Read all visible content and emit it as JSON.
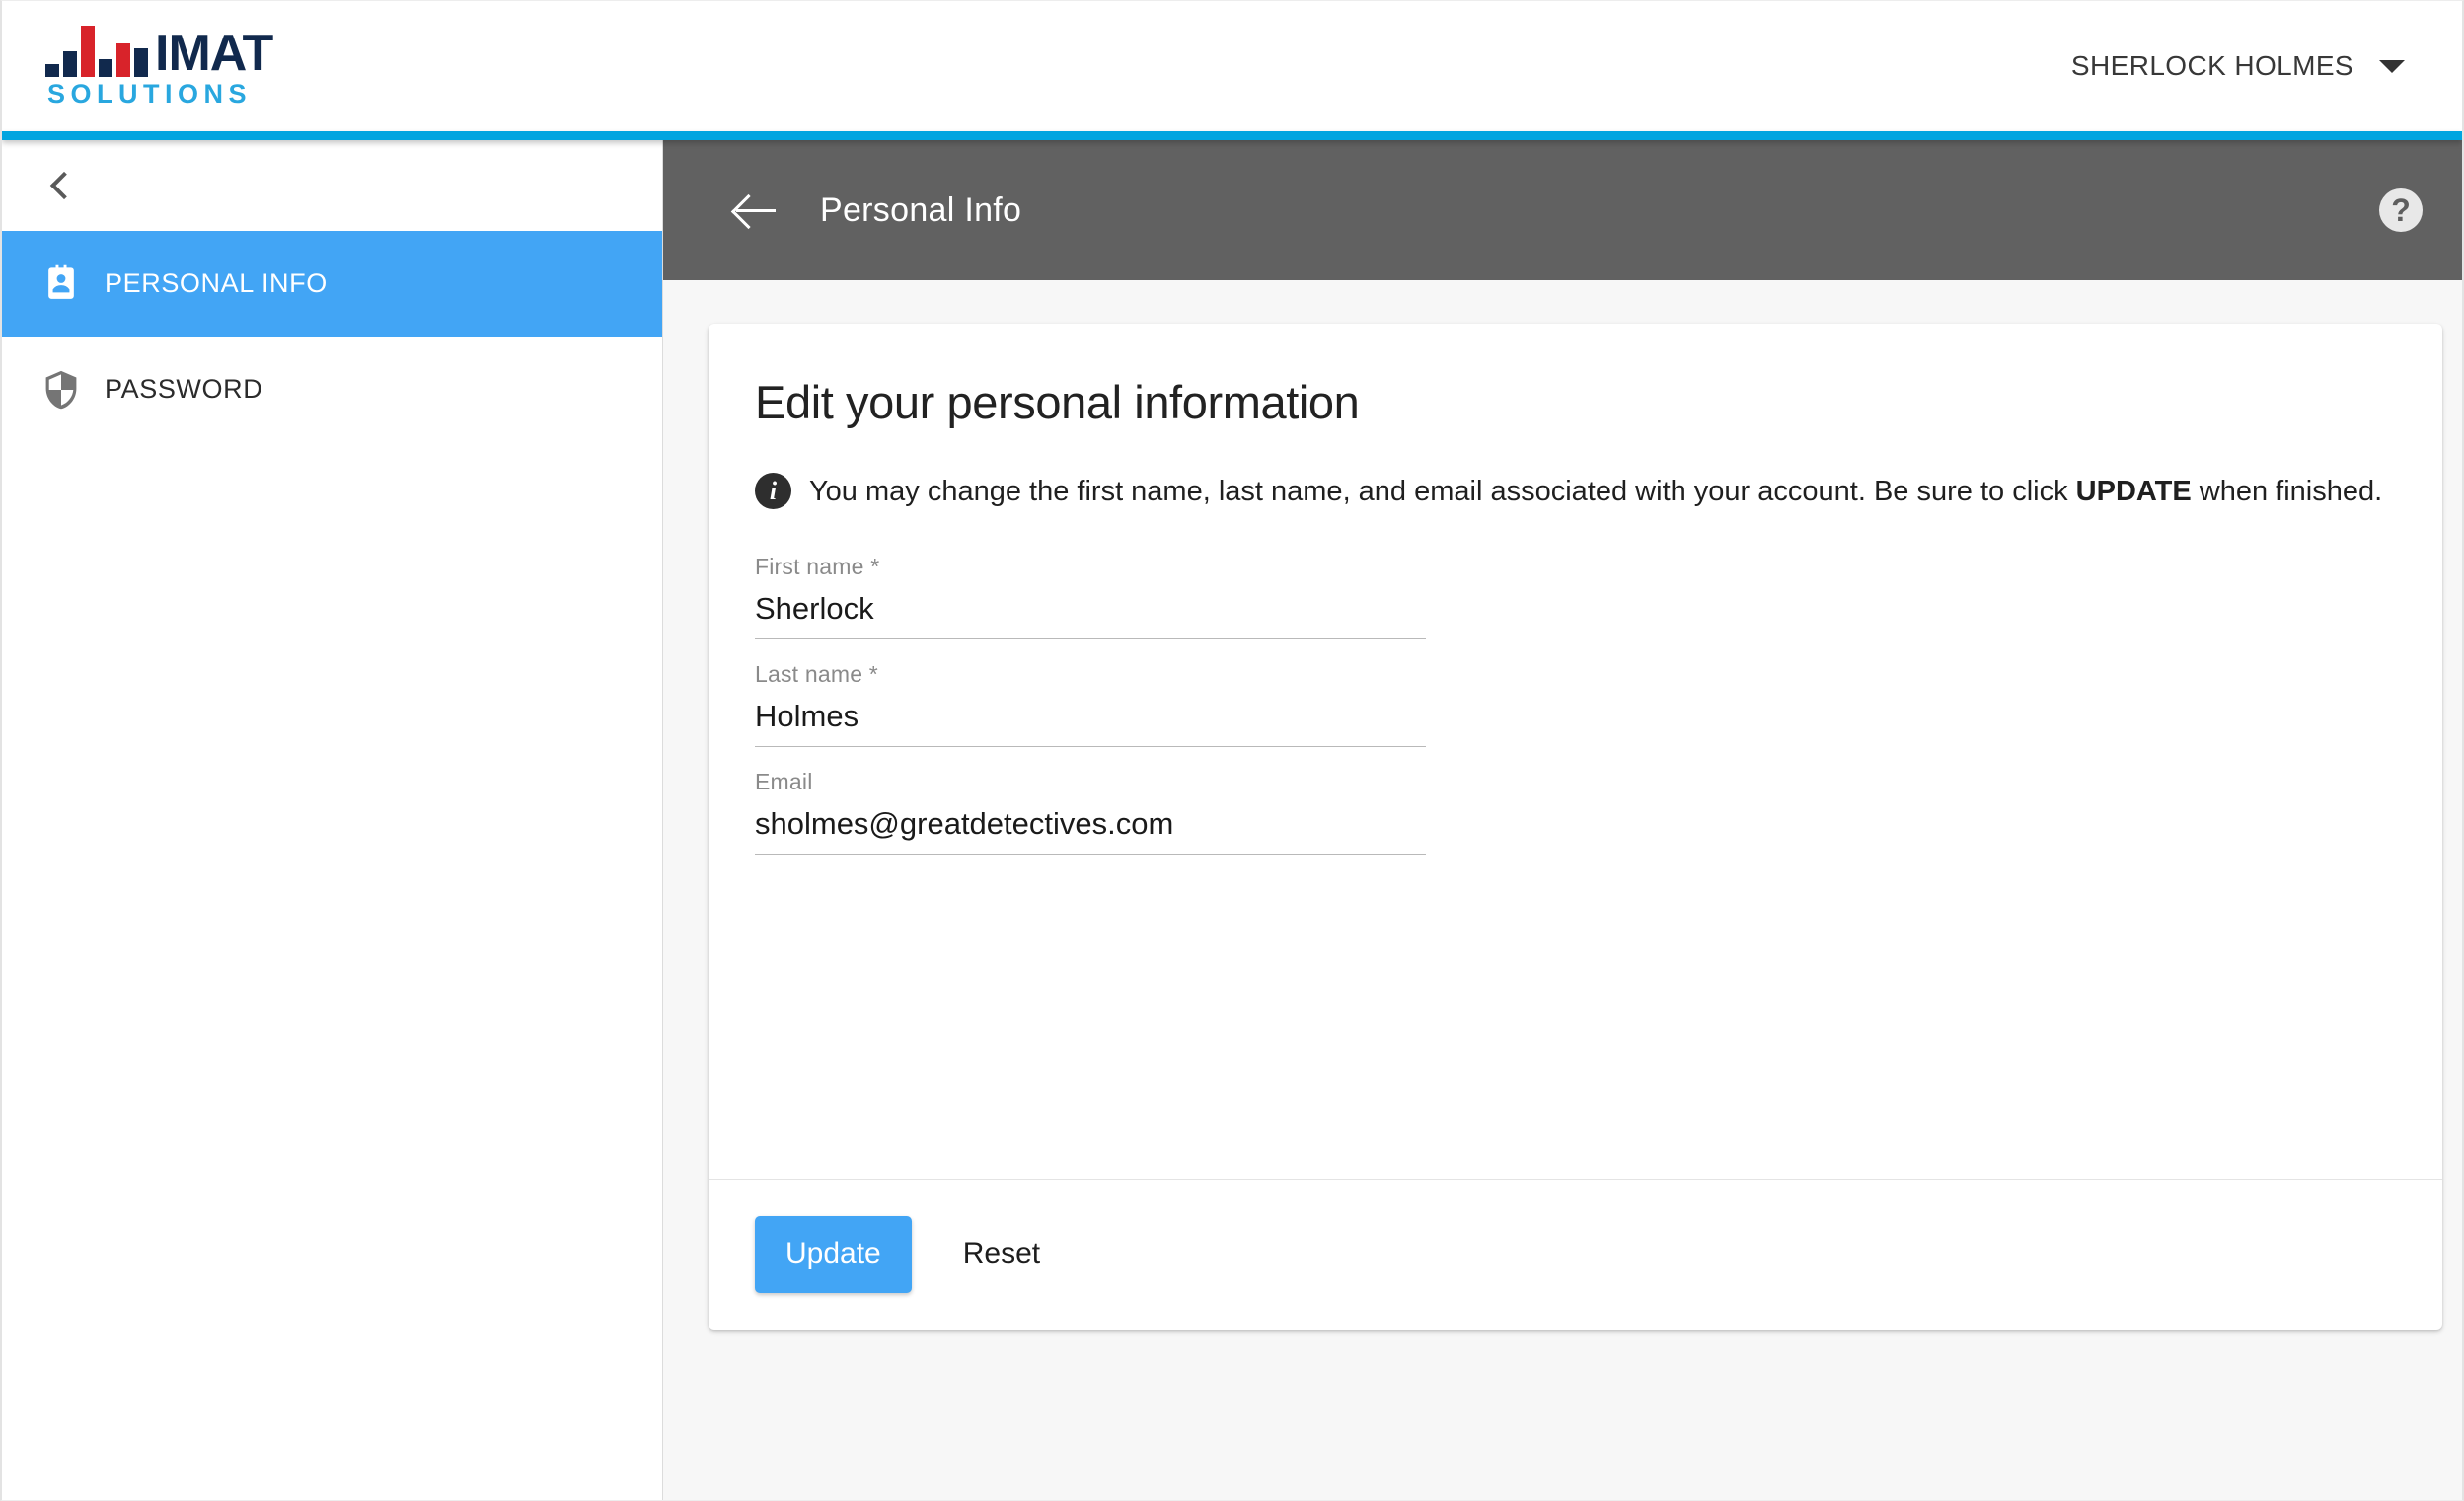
{
  "header": {
    "logo": {
      "primary_text": "IMAT",
      "secondary_text": "SOLUTIONS",
      "navy": "#11294d",
      "red": "#d8232a",
      "cyan": "#29a7df"
    },
    "user_menu": {
      "name": "SHERLOCK HOLMES",
      "caret_icon": "chevron-down-icon"
    },
    "accent_color": "#00a5e0"
  },
  "sidebar": {
    "collapse_icon": "chevron-left-icon",
    "items": [
      {
        "label": "PERSONAL INFO",
        "icon": "id-badge-icon",
        "active": true
      },
      {
        "label": "PASSWORD",
        "icon": "shield-icon",
        "active": false
      }
    ],
    "active_color": "#42a5f5"
  },
  "toolbar": {
    "back_icon": "arrow-left-icon",
    "title": "Personal Info",
    "help_icon": "help-circle-icon",
    "help_label": "?",
    "background": "#616161"
  },
  "card": {
    "title": "Edit your personal information",
    "info": {
      "icon": "info-circle-icon",
      "icon_label": "i",
      "text_before": "You may change the first name, last name, and email associated with your account. Be sure to click ",
      "emphasis": "UPDATE",
      "text_after": " when finished."
    },
    "fields": [
      {
        "label": "First name *",
        "value": "Sherlock",
        "placeholder": "First name"
      },
      {
        "label": "Last name *",
        "value": "Holmes",
        "placeholder": "Last name"
      },
      {
        "label": "Email",
        "value": "sholmes@greatdetectives.com",
        "placeholder": "Email"
      }
    ],
    "actions": {
      "update_label": "Update",
      "reset_label": "Reset",
      "update_color": "#42a5f5"
    }
  }
}
